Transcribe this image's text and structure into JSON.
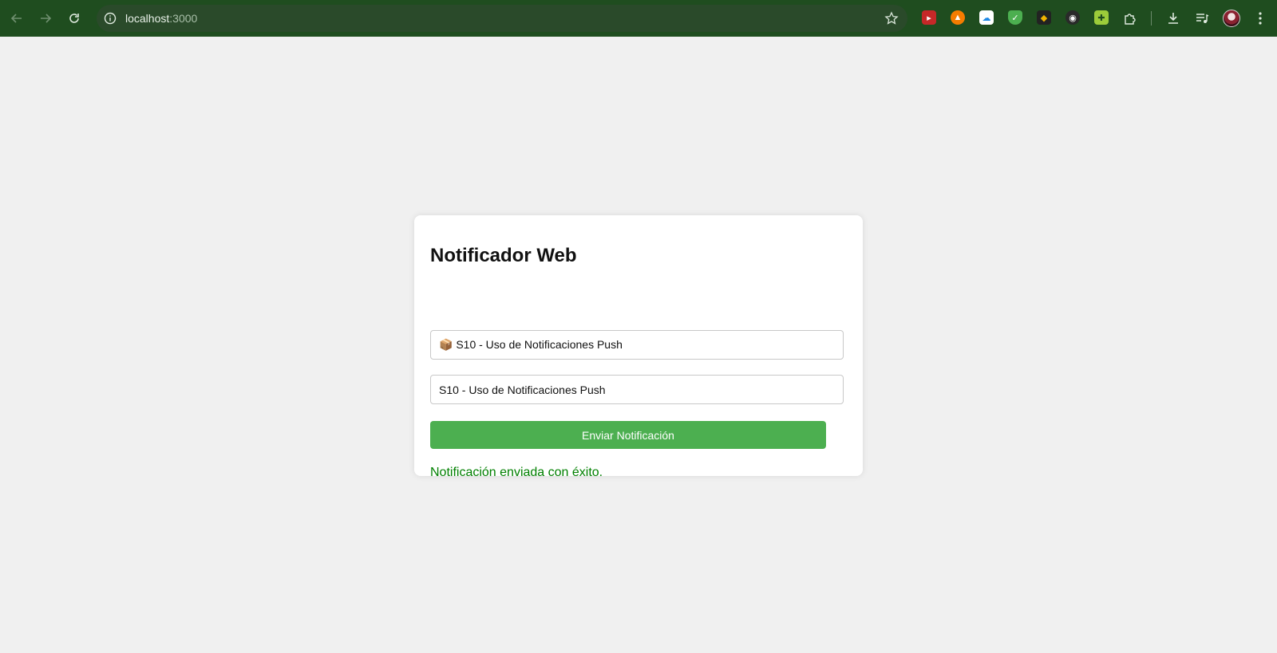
{
  "browser": {
    "url_host": "localhost",
    "url_port": ":3000",
    "icons": {
      "back": "arrow-left-icon",
      "forward": "arrow-right-icon",
      "reload": "reload-icon",
      "site_info": "info-icon",
      "bookmark": "star-icon",
      "extensions": "puzzle-icon",
      "downloads": "download-icon",
      "media": "playlist-icon",
      "menu": "kebab-menu-icon"
    },
    "colors": {
      "toolbar": "#1f4d1f",
      "omnibox": "#2a4a2a"
    }
  },
  "app": {
    "title": "Notificador Web",
    "title_input": {
      "value": "📦 S10 - Uso de Notificaciones Push"
    },
    "body_input": {
      "value": "S10 - Uso de Notificaciones Push"
    },
    "send_button_label": "Enviar Notificación",
    "status_message": "Notificación enviada con éxito.",
    "colors": {
      "button": "#4caf50",
      "success_text": "#008000",
      "background": "#f0f0f0"
    }
  }
}
